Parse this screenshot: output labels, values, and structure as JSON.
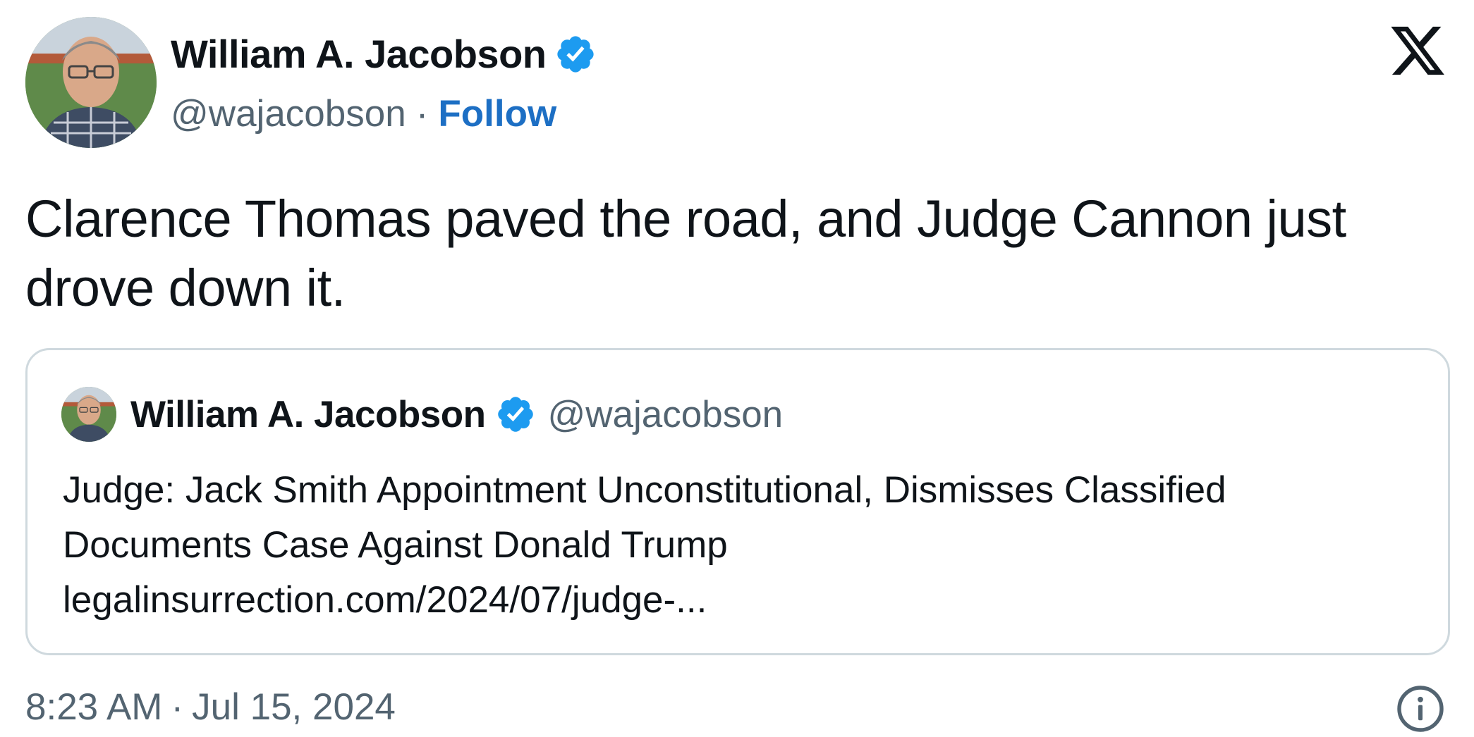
{
  "colors": {
    "text": "#0f1419",
    "muted": "#536471",
    "link": "#1d6fc4",
    "verified": "#1d9bf0",
    "border": "#cfd9de"
  },
  "author": {
    "name": "William A. Jacobson",
    "handle": "@wajacobson",
    "separator": "·",
    "follow_label": "Follow",
    "avatar_icon": "profile-photo",
    "verified_icon": "verified-badge-icon"
  },
  "brand_icon": "x-logo-icon",
  "tweet": {
    "text": "Clarence Thomas paved the road, and Judge Cannon just drove down it."
  },
  "quote": {
    "name": "William A. Jacobson",
    "handle": "@wajacobson",
    "lines": [
      "Judge: Jack Smith Appointment Unconstitutional, Dismisses Classified",
      "Documents Case Against Donald Trump",
      "legalinsurrection.com/2024/07/judge-..."
    ]
  },
  "footer": {
    "time": "8:23 AM",
    "separator": "·",
    "date": "Jul 15, 2024",
    "info_icon": "info-icon"
  }
}
